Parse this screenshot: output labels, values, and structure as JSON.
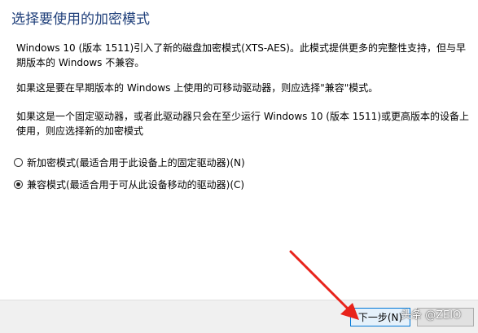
{
  "page": {
    "title": "选择要使用的加密模式",
    "paragraphs": [
      "Windows 10 (版本 1511)引入了新的磁盘加密模式(XTS-AES)。此模式提供更多的完整性支持，但与早期版本的 Windows 不兼容。",
      "如果这是要在早期版本的 Windows 上使用的可移动驱动器，则应选择\"兼容\"模式。",
      "如果这是一个固定驱动器，或者此驱动器只会在至少运行 Windows 10 (版本 1511)或更高版本的设备上使用，则应选择新的加密模式"
    ]
  },
  "options": [
    {
      "label": "新加密模式(最适合用于此设备上的固定驱动器)(N)",
      "selected": false
    },
    {
      "label": "兼容模式(最适合用于可从此设备移动的驱动器)(C)",
      "selected": true
    }
  ],
  "footer": {
    "next_label": "下一步(N)",
    "cancel_label": "",
    "watermark": "头条 @ZEIO"
  },
  "colors": {
    "title": "#1f3f7a",
    "annotation_arrow": "#e8231b",
    "next_border": "#0078d7"
  },
  "icons": {
    "annotation": "red-arrow-icon",
    "radio_unchecked": "radio-unchecked-icon",
    "radio_checked": "radio-checked-icon"
  }
}
